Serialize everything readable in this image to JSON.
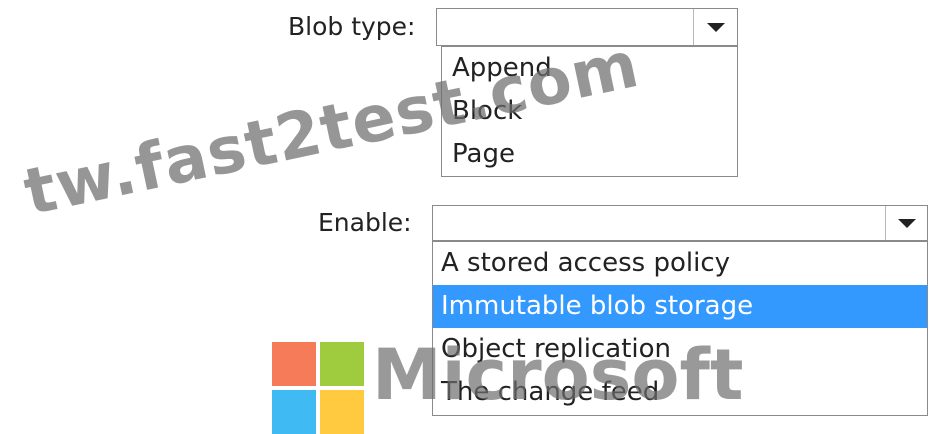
{
  "blob_type": {
    "label": "Blob type:",
    "selected": "",
    "options": [
      "Append",
      "Block",
      "Page"
    ]
  },
  "enable": {
    "label": "Enable:",
    "selected": "",
    "options": [
      "A stored access policy",
      "Immutable blob storage",
      "Object replication",
      "The change feed"
    ],
    "highlighted": "Immutable blob storage"
  },
  "watermark": {
    "text": "tw.fast2test.com",
    "brand": "Microsoft",
    "logo_colors": [
      "#f25022",
      "#7fba00",
      "#00a4ef",
      "#ffb900"
    ]
  },
  "icons": {
    "dropdown_arrow": "chevron-down-icon"
  },
  "colors": {
    "selection_highlight": "#3399ff"
  }
}
